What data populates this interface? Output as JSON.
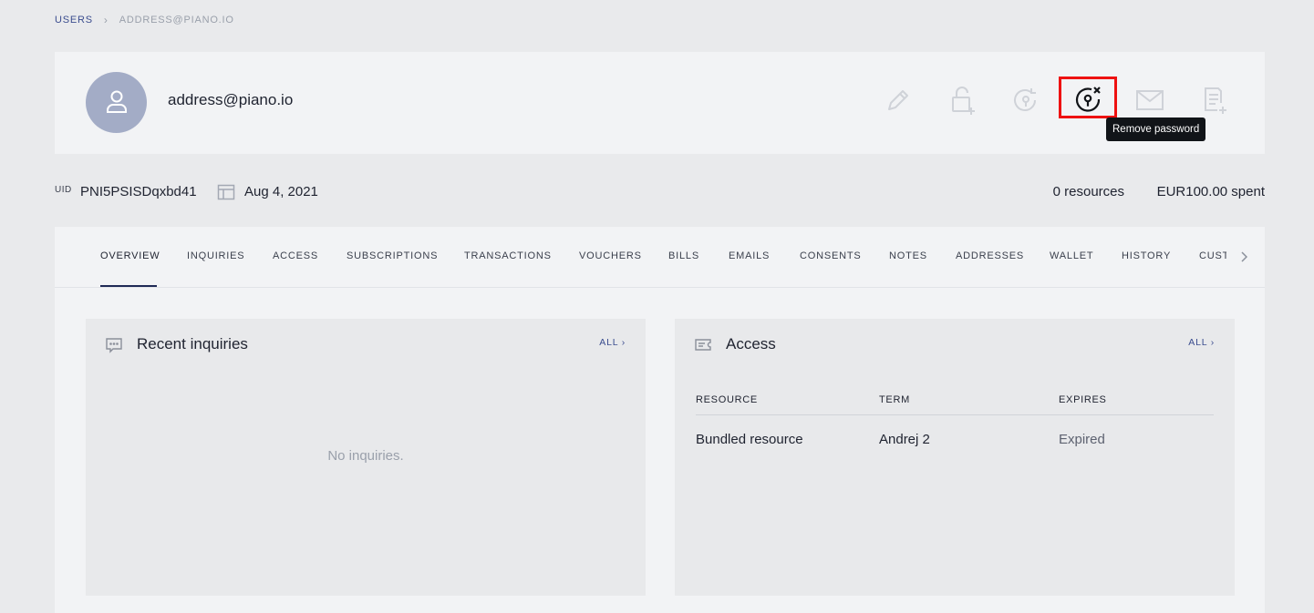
{
  "breadcrumb": {
    "parent": "USERS",
    "separator": "›",
    "current": "ADDRESS@PIANO.IO"
  },
  "user": {
    "email": "address@piano.io",
    "uid_label": "UID",
    "uid": "PNI5PSISDqxbd41",
    "date": "Aug 4, 2021",
    "resources": "0 resources",
    "spent": "EUR100.00 spent"
  },
  "actions": [
    {
      "icon": "pencil-icon"
    },
    {
      "icon": "unlock-add-icon"
    },
    {
      "icon": "reset-password-icon"
    },
    {
      "icon": "remove-password-icon"
    },
    {
      "icon": "mail-icon"
    },
    {
      "icon": "document-add-icon"
    }
  ],
  "tooltip": "Remove password",
  "tabs": {
    "items": [
      "OVERVIEW",
      "INQUIRIES",
      "ACCESS",
      "SUBSCRIPTIONS",
      "TRANSACTIONS",
      "VOUCHERS",
      "BILLS",
      "EMAILS",
      "CONSENTS",
      "NOTES",
      "ADDRESSES",
      "WALLET",
      "HISTORY",
      "CUSTOM FIELDS"
    ],
    "active": "OVERVIEW"
  },
  "inquiries_panel": {
    "title": "Recent inquiries",
    "all_link": "ALL ›",
    "empty": "No inquiries."
  },
  "access_panel": {
    "title": "Access",
    "all_link": "ALL ›",
    "columns": [
      "RESOURCE",
      "TERM",
      "EXPIRES"
    ],
    "rows": [
      [
        "Bundled resource",
        "Andrej 2",
        "Expired"
      ]
    ]
  },
  "colors": {
    "accent": "#3b4d8f",
    "highlight": "#ee1111",
    "avatar": "#a3acc6",
    "tooltip_bg": "#111418"
  }
}
